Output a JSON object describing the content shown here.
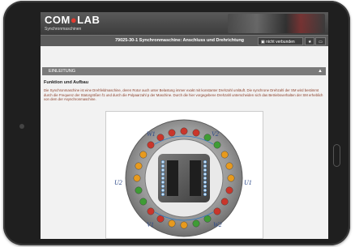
{
  "app": {
    "brand_prefix": "COM",
    "brand_suffix": "LAB",
    "subtitle": "Synchronmaschinen"
  },
  "toolbar": {
    "page_title": "79025-30-1 Synchronmaschine: Anschluss und Drehrichtung",
    "connection_status": "nicht verbunden",
    "star_icon": "star-icon",
    "folder_icon": "folder-icon"
  },
  "section": {
    "label": "EINLEITUNG",
    "caret": "▲"
  },
  "body": {
    "heading": "Funktion und Aufbau",
    "paragraph": "Die Synchronmaschine ist eine Drehfeldmaschine, deren Rotor auch unter Belastung immer exakt mit konstanter Drehzahl umläuft. Die synchrone Drehzahl der SM wird bestimmt durch die Frequenz der Statorgrößen f1 und durch die Polpaarzahl p der Maschine. Durch die hier vorgegebene Drehzahl unterscheiden sich das Betriebsverhalten der SM erheblich von dem der Asynchronmaschine."
  },
  "diagram": {
    "labels": [
      "W1",
      "V2",
      "U2",
      "U1",
      "V1",
      "W2"
    ],
    "colors": {
      "red": "#c9362b",
      "green": "#3f9c35",
      "orange": "#e79a1e",
      "stator": "#8f8f8f",
      "rotor": "#5d5d5d",
      "coil": "#2d7ac0"
    }
  }
}
